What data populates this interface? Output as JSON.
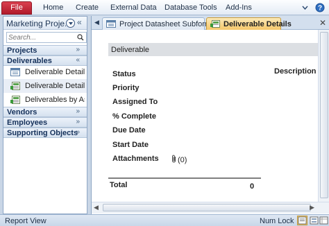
{
  "ribbon": {
    "file_label": "File",
    "tabs": [
      "Home",
      "Create",
      "External Data",
      "Database Tools",
      "Add-Ins"
    ],
    "icons": [
      "help-icon",
      "minimize-ribbon-icon"
    ]
  },
  "nav": {
    "title": "Marketing Proje...",
    "search_placeholder": "Search...",
    "groups": {
      "projects": "Projects",
      "deliverables": "Deliverables",
      "vendors": "Vendors",
      "employees": "Employees",
      "supporting": "Supporting Objects"
    },
    "items": [
      {
        "label": "Deliverable Details",
        "icon": "form-icon"
      },
      {
        "label": "Deliverable Details",
        "icon": "report-icon"
      },
      {
        "label": "Deliverables by As...",
        "icon": "report-icon"
      }
    ]
  },
  "doc": {
    "tabs": [
      {
        "label": "Project Datasheet Subform",
        "icon": "form-icon"
      },
      {
        "label": "Deliverable Details",
        "icon": "report-icon"
      }
    ],
    "form": {
      "header": "Deliverable",
      "description_label": "Description",
      "fields": [
        "Status",
        "Priority",
        "Assigned To",
        "% Complete",
        "Due Date",
        "Start Date",
        "Attachments"
      ],
      "attachments_count": "(0)",
      "total_label": "Total",
      "total_value": "0"
    }
  },
  "status": {
    "left": "Report View",
    "numlock": "Num Lock"
  },
  "colors": {
    "file_tab": "#c8283a",
    "active_tab": "#f5c76a",
    "accent": "#14305a"
  }
}
